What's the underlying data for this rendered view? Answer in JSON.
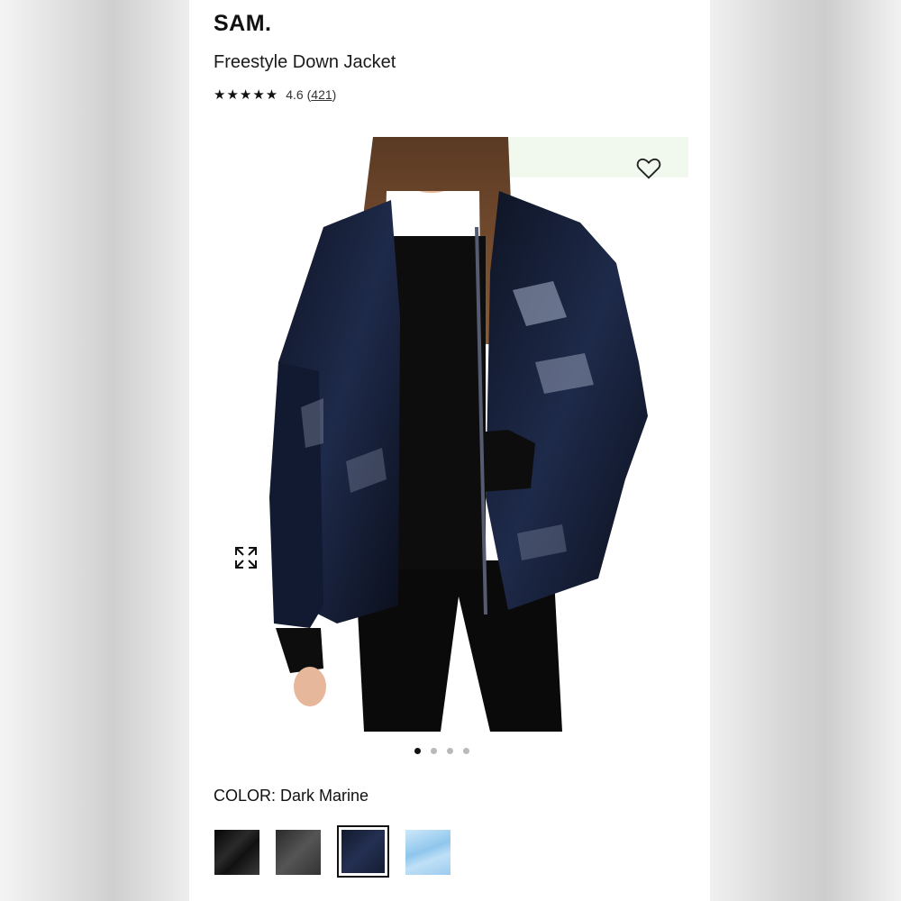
{
  "brand": "SAM.",
  "product": {
    "name": "Freestyle Down Jacket",
    "stars": "★★★★★",
    "rating": "4.6",
    "review_count_open": "(",
    "review_count": "421",
    "review_count_close": ")"
  },
  "gallery": {
    "image_alt": "Model wearing glossy Dark Marine down jacket",
    "dots": 4,
    "active_dot": 1
  },
  "color": {
    "label": "COLOR:",
    "value": "Dark Marine"
  },
  "swatches": [
    {
      "name": "Black",
      "color": "#151515"
    },
    {
      "name": "Charcoal",
      "color": "#3a3a3a"
    },
    {
      "name": "Dark Marine",
      "color": "#1d2540",
      "selected": true
    },
    {
      "name": "Light Blue",
      "color": "#a9d4f0"
    }
  ],
  "icons": {
    "wishlist": "heart-icon",
    "expand": "expand-icon"
  }
}
